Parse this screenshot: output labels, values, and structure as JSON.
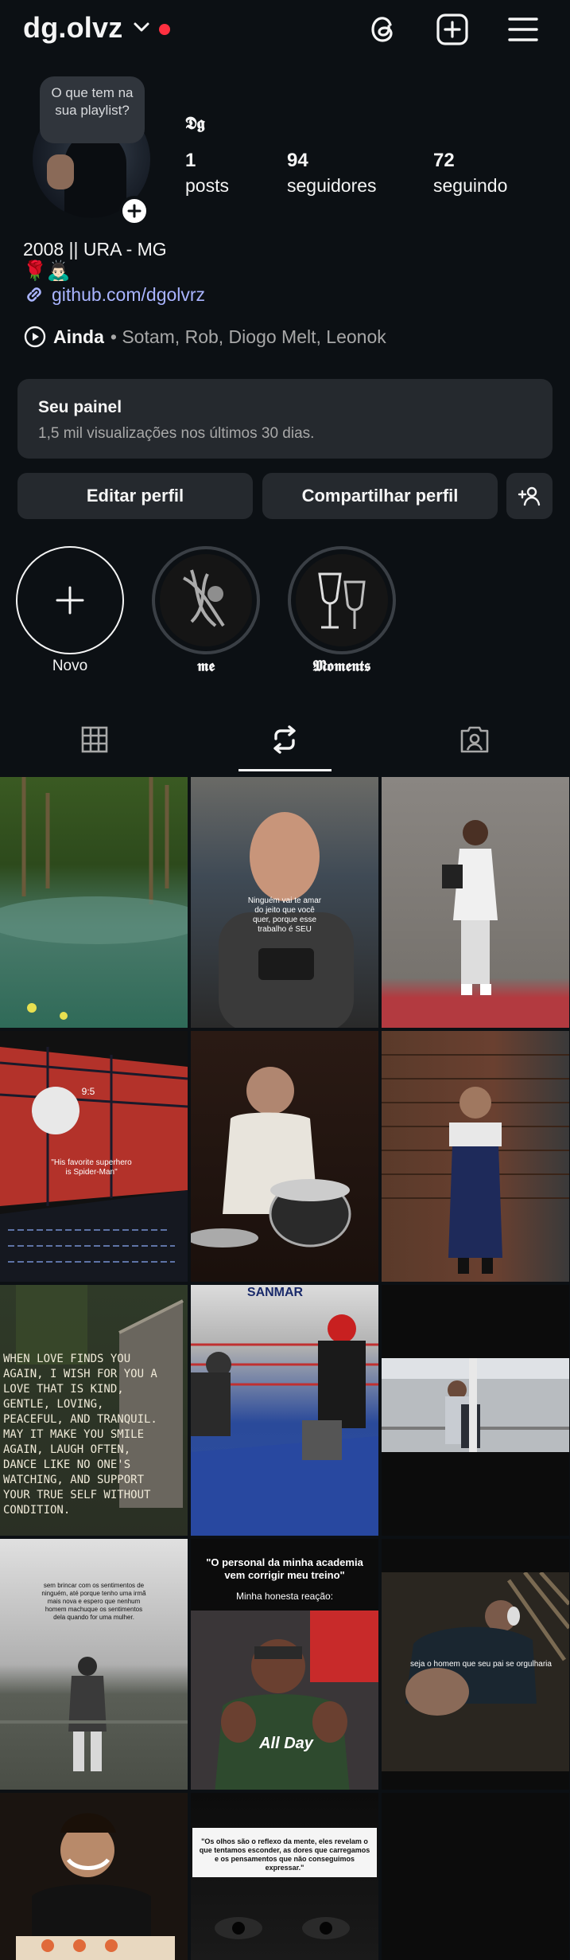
{
  "header": {
    "username": "dg.olvz",
    "icons": [
      "chevron-down-icon",
      "threads-icon",
      "new-post-icon",
      "menu-icon"
    ]
  },
  "profile": {
    "note_text": "O que tem na sua playlist?",
    "display_name": "𝕯𝖌",
    "stats": [
      {
        "value": "1",
        "label": "posts"
      },
      {
        "value": "94",
        "label": "seguidores"
      },
      {
        "value": "72",
        "label": "seguindo"
      }
    ],
    "bio_line1": "2008 || URA - MG",
    "bio_line2": "🌹🙇🏻‍♂️",
    "link": "github.com/dgolvrz",
    "music_title": "Ainda",
    "music_artists": "• Sotam, Rob, Diogo Melt, Leonok"
  },
  "dashboard": {
    "title": "Seu painel",
    "subtitle": "1,5 mil visualizações nos últimos 30 dias."
  },
  "actions": {
    "edit": "Editar perfil",
    "share": "Compartilhar perfil"
  },
  "highlights": [
    {
      "label": "Novo"
    },
    {
      "label": "𝖒𝖊"
    },
    {
      "label": "𝕸𝖔𝖒𝖊𝖓𝖙𝖘"
    }
  ],
  "tabs": [
    "grid-icon",
    "reposts-icon",
    "tagged-icon"
  ],
  "grid_captions": {
    "p2": "Ninguém vai te amar do jeito que você quer, porque esse trabalho é SEU",
    "p4": "\"His favorite superhero is Spider-Man\"",
    "p7": "WHEN LOVE FINDS YOU AGAIN, I WISH FOR YOU A LOVE THAT IS KIND, GENTLE, LOVING, PEACEFUL, AND TRANQUIL. MAY IT MAKE YOU SMILE AGAIN, LAUGH OFTEN, DANCE LIKE NO ONE'S WATCHING, AND SUPPORT YOUR TRUE SELF WITHOUT CONDITION.",
    "p7_brand": "SANMAR",
    "p10": "sem brincar com os sentimentos de ninguém, até porque tenho uma irmã mais nova e espero que nenhum homem machuque os sentimentos dela quando for uma mulher.",
    "p11_title": "\"O personal da minha academia vem corrigir meu treino\"",
    "p11_sub": "Minha honesta reação:",
    "p11_shirt": "All Day",
    "p12": "seja o homem que seu pai se orgulharia",
    "p14": "\"Os olhos são o reflexo da mente, eles revelam o que tentamos esconder, as dores que carregamos e os pensamentos que não conseguimos expressar.\"",
    "p4_time": "9:5"
  },
  "colors": {
    "background": "#0c1014",
    "surface": "#25292e",
    "link": "#a9b4ff",
    "notification_dot": "#ff3040"
  }
}
